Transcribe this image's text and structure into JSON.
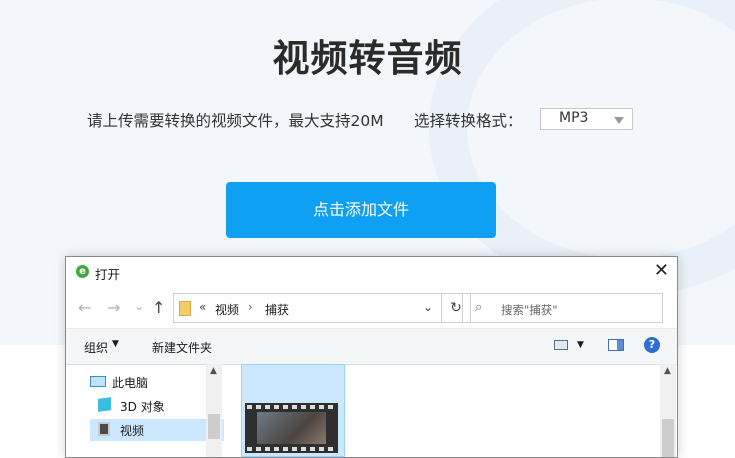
{
  "page": {
    "title": "视频转音频",
    "hint": "请上传需要转换的视频文件，最大支持20M",
    "format_label": "选择转换格式：",
    "format_value": "MP3",
    "add_button": "点击添加文件"
  },
  "dialog": {
    "title": "打开",
    "close": "✕",
    "nav": {
      "back": "←",
      "forward": "→",
      "recent": "⌄",
      "up": "↑"
    },
    "address": {
      "prefix": "«",
      "segments": [
        "视频",
        "捕获"
      ],
      "separator": "›",
      "dropdown": "⌄"
    },
    "refresh": "↻",
    "search_placeholder": "搜索\"捕获\"",
    "search_icon": "⌕",
    "toolbar": {
      "organize": "组织",
      "organize_caret": "▼",
      "new_folder": "新建文件夹",
      "view_caret": "▼",
      "help": "?"
    },
    "tree": [
      {
        "label": "此电脑",
        "icon": "computer-icon"
      },
      {
        "label": "3D 对象",
        "icon": "3d-objects-icon"
      },
      {
        "label": "视频",
        "icon": "video-folder-icon"
      }
    ],
    "scroll_up": "▲"
  },
  "colors": {
    "accent": "#0fa0f4",
    "hero_bg": "#f3f7fb",
    "selection": "#cce8ff"
  }
}
